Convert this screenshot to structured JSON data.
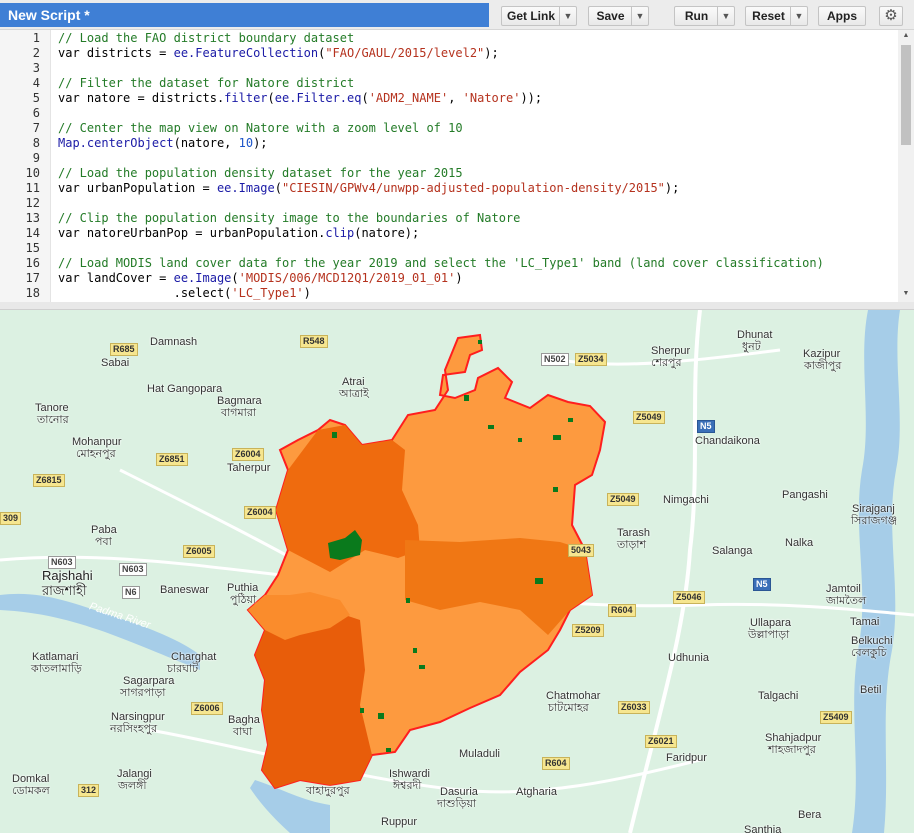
{
  "toolbar": {
    "title": "New Script *",
    "get_link": "Get Link",
    "save": "Save",
    "run": "Run",
    "reset": "Reset",
    "apps": "Apps",
    "dropdown_glyph": "▼",
    "settings_icon": "gear-icon"
  },
  "editor": {
    "line_numbers": [
      "1",
      "2",
      "3",
      "4",
      "5",
      "6",
      "7",
      "8",
      "9",
      "10",
      "11",
      "12",
      "13",
      "14",
      "15",
      "16",
      "17",
      "18"
    ],
    "lines": {
      "l1": "// Load the FAO district boundary dataset",
      "l2a": "var districts = ",
      "l2b": "ee.FeatureCollection",
      "l2c": "(",
      "l2d": "\"FAO/GAUL/2015/level2\"",
      "l2e": ");",
      "l4": "// Filter the dataset for Natore district",
      "l5a": "var natore = districts.",
      "l5b": "filter",
      "l5c": "(",
      "l5d": "ee.Filter.eq",
      "l5e": "(",
      "l5f": "'ADM2_NAME'",
      "l5g": ", ",
      "l5h": "'Natore'",
      "l5i": "));",
      "l7": "// Center the map view on Natore with a zoom level of 10",
      "l8a": "Map.centerObject",
      "l8b": "(natore, ",
      "l8c": "10",
      "l8d": ");",
      "l10": "// Load the population density dataset for the year 2015",
      "l11a": "var urbanPopulation = ",
      "l11b": "ee.Image",
      "l11c": "(",
      "l11d": "\"CIESIN/GPWv4/unwpp-adjusted-population-density/2015\"",
      "l11e": ");",
      "l13": "// Clip the population density image to the boundaries of Natore",
      "l14a": "var natoreUrbanPop = urbanPopulation.",
      "l14b": "clip",
      "l14c": "(natore);",
      "l16": "// Load MODIS land cover data for the year 2019 and select the 'LC_Type1' band (land cover classification)",
      "l17a": "var landCover = ",
      "l17b": "ee.Image",
      "l17c": "(",
      "l17d": "'MODIS/006/MCD12Q1/2019_01_01'",
      "l17e": ")",
      "l18a": "                .select(",
      "l18b": "'LC_Type1'",
      "l18c": ")"
    }
  },
  "map": {
    "places": {
      "damnash": "Damnash",
      "sabai": "Sabai",
      "hat_gangopara": "Hat Gangopara",
      "bagmara": "Bagmara",
      "bagmara_bn": "বাগমারা",
      "tanore": "Tanore",
      "tanore_bn": "তানোর",
      "mohanpur": "Mohanpur",
      "mohanpur_bn": "মোহনপুর",
      "taherpur": "Taherpur",
      "atrai": "Atrai",
      "atrai_bn": "আত্রাই",
      "paba": "Paba",
      "paba_bn": "পবা",
      "rajshahi": "Rajshahi",
      "rajshahi_bn": "রাজশাহী",
      "baneswar": "Baneswar",
      "puthia": "Puthia",
      "puthia_bn": "পুঠিয়া",
      "katlamari": "Katlamari",
      "katlamari_bn": "কাতলামাড়ি",
      "charghat": "Charghat",
      "charghat_bn": "চারঘাট",
      "sagarpara": "Sagarpara",
      "sagarpara_bn": "সাগরপাড়া",
      "narsingpur": "Narsingpur",
      "narsingpur_bn": "নরসিংহপুর",
      "bagha": "Bagha",
      "bagha_bn": "বাঘা",
      "domkal": "Domkal",
      "domkal_bn": "ডোমকল",
      "jalangi": "Jalangi",
      "jalangi_bn": "জলঙ্গী",
      "dhunat": "Dhunat",
      "dhunat_bn": "ধুনট",
      "sherpur": "Sherpur",
      "sherpur_bn": "শেরপুর",
      "kazipur": "Kazipur",
      "kazipur_bn": "কাজীপুর",
      "chandaikona": "Chandaikona",
      "nimgachi": "Nimgachi",
      "pangashi": "Pangashi",
      "sirajganj": "Sirajganj",
      "sirajganj_bn": "সিরাজগঞ্জ",
      "tarash": "Tarash",
      "tarash_bn": "তাড়াশ",
      "salanga": "Salanga",
      "nalka": "Nalka",
      "jamtoil": "Jamtoil",
      "jamtoil_bn": "জামতৈল",
      "ullapara": "Ullapara",
      "ullapara_bn": "উল্লাপাড়া",
      "tamai": "Tamai",
      "belkuchi": "Belkuchi",
      "belkuchi_bn": "বেলকুচি",
      "udhunia": "Udhunia",
      "chatmohar": "Chatmohar",
      "chatmohar_bn": "চাটমোহর",
      "betil": "Betil",
      "talgachi": "Talgachi",
      "shahjadpur": "Shahjadpur",
      "shahjadpur_bn": "শাহজাদপুর",
      "faridpur": "Faridpur",
      "muladuli": "Muladuli",
      "ishwardi": "Ishwardi",
      "ishwardi_bn": "ঈশ্বরদী",
      "dasuria": "Dasuria",
      "dasuria_bn": "দাশুড়িয়া",
      "atgharia": "Atgharia",
      "ruppur": "Ruppur",
      "bahadurpur_bn": "বাহাদুরপুর",
      "bera": "Bera",
      "santhia": "Santhia",
      "padma_river": "Padma River"
    },
    "shields": {
      "r685": "R685",
      "r548": "R548",
      "n502": "N502",
      "z5034": "Z5034",
      "z5049a": "Z5049",
      "n5a": "N5",
      "z6851": "Z6851",
      "z6004a": "Z6004",
      "z6815": "Z6815",
      "z6004b": "Z6004",
      "z5049b": "Z5049",
      "z6005": "Z6005",
      "n603a": "N603",
      "n603b": "N603",
      "n6": "N6",
      "z5043": "5043",
      "n5b": "N5",
      "z5046": "Z5046",
      "r604a": "R604",
      "z5209": "Z5209",
      "z6006": "Z6006",
      "z6033": "Z6033",
      "z6021": "Z6021",
      "r604b": "R604",
      "z5409": "Z5409",
      "r312": "312",
      "r309": "309"
    }
  }
}
